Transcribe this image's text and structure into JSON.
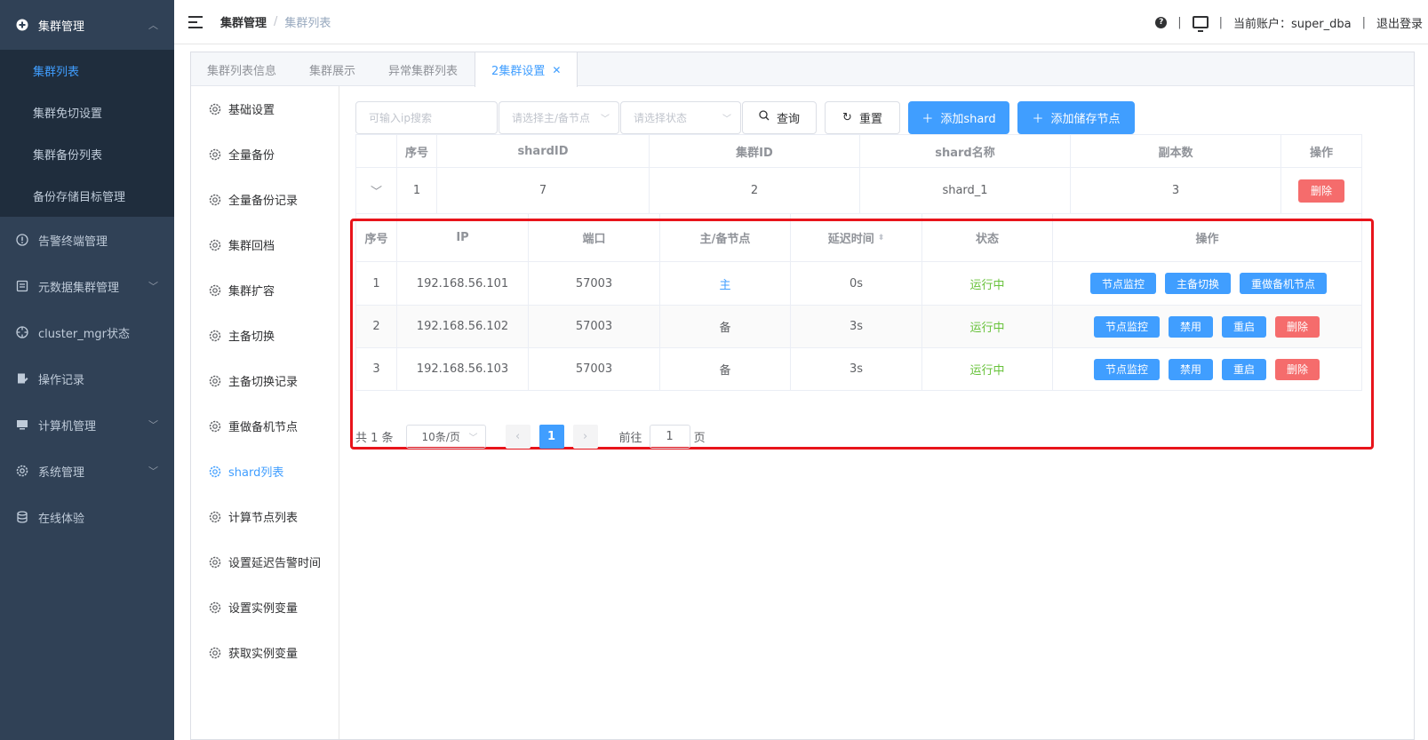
{
  "sidebar": {
    "group_title": "集群管理",
    "sub_items": [
      "集群列表",
      "集群免切设置",
      "集群备份列表",
      "备份存储目标管理"
    ],
    "items": [
      {
        "label": "告警终端管理",
        "icon": "alert-circle-icon",
        "arrow": false
      },
      {
        "label": "元数据集群管理",
        "icon": "database-box-icon",
        "arrow": true
      },
      {
        "label": "cluster_mgr状态",
        "icon": "crosshair-icon",
        "arrow": false
      },
      {
        "label": "操作记录",
        "icon": "edit-doc-icon",
        "arrow": false
      },
      {
        "label": "计算机管理",
        "icon": "monitor-icon",
        "arrow": true
      },
      {
        "label": "系统管理",
        "icon": "gear-icon",
        "arrow": true
      },
      {
        "label": "在线体验",
        "icon": "database-icon",
        "arrow": false
      }
    ]
  },
  "header": {
    "breadcrumb": [
      "集群管理",
      "集群列表"
    ],
    "account": "当前账户：super_dba",
    "logout": "退出登录"
  },
  "tabs": [
    {
      "label": "集群列表信息",
      "active": false
    },
    {
      "label": "集群展示",
      "active": false
    },
    {
      "label": "异常集群列表",
      "active": false
    },
    {
      "label": "2集群设置",
      "active": true
    }
  ],
  "settings_menu": [
    "基础设置",
    "全量备份",
    "全量备份记录",
    "集群回档",
    "集群扩容",
    "主备切换",
    "主备切换记录",
    "重做备机节点",
    "shard列表",
    "计算节点列表",
    "设置延迟告警时间",
    "设置实例变量",
    "获取实例变量"
  ],
  "settings_active": "shard列表",
  "toolbar": {
    "ip_placeholder": "可输入ip搜索",
    "role_placeholder": "请选择主/备节点",
    "status_placeholder": "请选择状态",
    "query": "查询",
    "reset": "重置",
    "add_shard": "添加shard",
    "add_storage": "添加储存节点"
  },
  "shard_table": {
    "headers": [
      "序号",
      "shardID",
      "集群ID",
      "shard名称",
      "副本数",
      "操作"
    ],
    "row": {
      "index": "1",
      "shard_id": "7",
      "cluster_id": "2",
      "name": "shard_1",
      "replicas": "3",
      "delete": "删除"
    }
  },
  "node_table": {
    "headers": [
      "序号",
      "IP",
      "端口",
      "主/备节点",
      "延迟时间",
      "状态",
      "操作"
    ],
    "rows": [
      {
        "index": "1",
        "ip": "192.168.56.101",
        "port": "57003",
        "role": "主",
        "delay": "0s",
        "status": "运行中",
        "actions": [
          "节点监控",
          "主备切换",
          "重做备机节点"
        ]
      },
      {
        "index": "2",
        "ip": "192.168.56.102",
        "port": "57003",
        "role": "备",
        "delay": "3s",
        "status": "运行中",
        "actions": [
          "节点监控",
          "禁用",
          "重启",
          "删除"
        ]
      },
      {
        "index": "3",
        "ip": "192.168.56.103",
        "port": "57003",
        "role": "备",
        "delay": "3s",
        "status": "运行中",
        "actions": [
          "节点监控",
          "禁用",
          "重启",
          "删除"
        ]
      }
    ]
  },
  "pager": {
    "total": "共 1 条",
    "page_size": "10条/页",
    "current": "1",
    "goto_label": "前往",
    "goto_value": "1",
    "page_unit": "页"
  },
  "colors": {
    "sidebar_bg": "#304156",
    "accent": "#409eff",
    "danger": "#f56c6c",
    "success": "#67c23a",
    "highlight": "#e8141b"
  }
}
